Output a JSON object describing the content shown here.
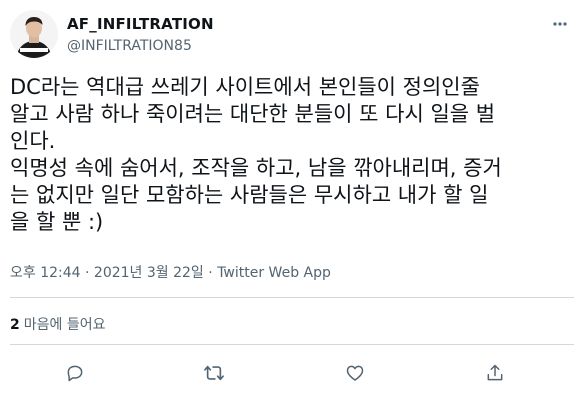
{
  "user": {
    "display_name": "AF_INFILTRATION",
    "handle": "@INFILTRATION85"
  },
  "tweet": {
    "text": "DC라는 역대급 쓰레기 사이트에서 본인들이 정의인줄\n알고 사람 하나 죽이려는 대단한 분들이 또 다시 일을 벌\n인다.\n익명성 속에 숨어서, 조작을 하고, 남을 깎아내리며, 증거\n는 없지만 일단 모함하는 사람들은 무시하고 내가 할 일\n을 할 뿐 :)"
  },
  "meta": {
    "time": "오후 12:44",
    "separator1": " · ",
    "date": "2021년 3월 22일",
    "separator2": " · ",
    "source": "Twitter Web App"
  },
  "likes": {
    "count": "2",
    "label": "마음에 들어요"
  },
  "icons": {
    "more": "more-icon",
    "reply": "reply-icon",
    "retweet": "retweet-icon",
    "like": "like-icon",
    "share": "share-icon"
  },
  "colors": {
    "text": "#0f1419",
    "secondary": "#536471",
    "divider": "#cfd9de"
  }
}
